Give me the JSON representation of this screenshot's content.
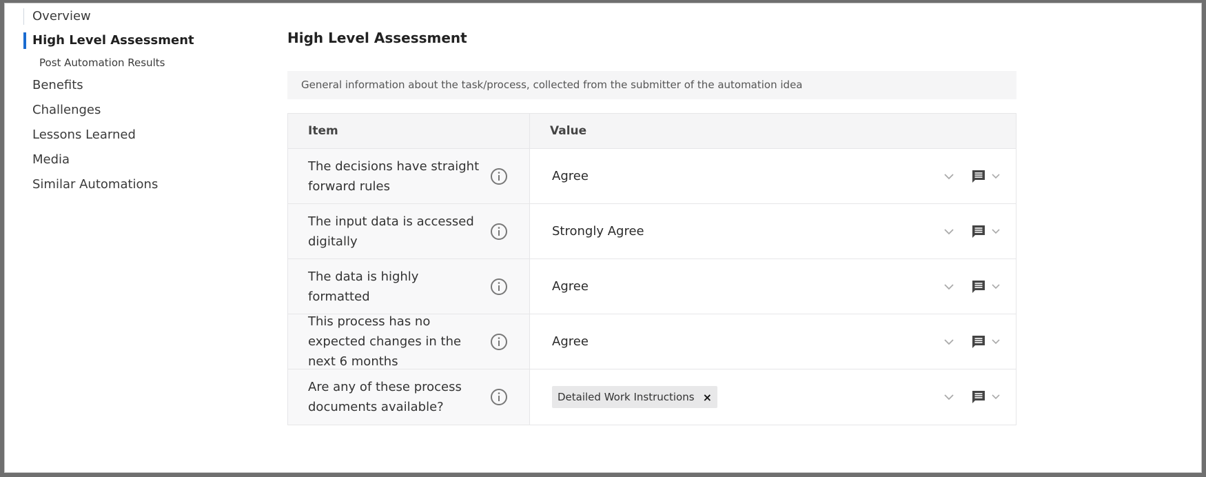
{
  "sidebar": {
    "items": [
      {
        "label": "Overview"
      },
      {
        "label": "High Level Assessment"
      },
      {
        "label": "Post Automation Results"
      },
      {
        "label": "Benefits"
      },
      {
        "label": "Challenges"
      },
      {
        "label": "Lessons Learned"
      },
      {
        "label": "Media"
      },
      {
        "label": "Similar Automations"
      }
    ]
  },
  "main": {
    "title": "High Level Assessment",
    "info": "General information about the task/process, collected from the submitter of the automation idea",
    "table": {
      "headers": {
        "item": "Item",
        "value": "Value"
      },
      "rows": [
        {
          "item": "The decisions have straight forward rules",
          "value": "Agree"
        },
        {
          "item": "The input data is accessed digitally",
          "value": "Strongly Agree"
        },
        {
          "item": "The data is highly formatted",
          "value": "Agree"
        },
        {
          "item": "This process has no expected changes in the next 6 months",
          "value": "Agree"
        },
        {
          "item": "Are any of these process documents available?",
          "tag": "Detailed Work Instructions",
          "tag_remove": "×"
        }
      ]
    }
  },
  "colors": {
    "accent": "#1a6bd0",
    "header_bg": "#f5f5f6",
    "border": "#e6e6e8"
  },
  "icons": {
    "info": "info-circle-icon",
    "dropdown": "chevron-down-icon",
    "comment": "comment-icon"
  }
}
